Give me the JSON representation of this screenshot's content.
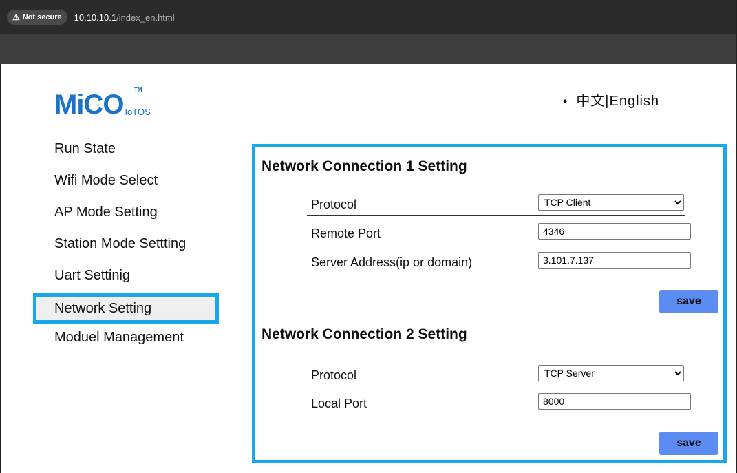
{
  "browser": {
    "security_label": "Not secure",
    "url_host": "10.10.10.1",
    "url_path": "/index_en.html"
  },
  "logo": {
    "text": "MiCO",
    "sub": "IoTOS",
    "tm": "TM"
  },
  "language": {
    "text": "中文|English"
  },
  "sidebar": {
    "items": [
      {
        "label": "Run State"
      },
      {
        "label": "Wifi Mode Select"
      },
      {
        "label": "AP Mode Setting"
      },
      {
        "label": "Station Mode Settting"
      },
      {
        "label": "Uart Settinig"
      },
      {
        "label": "Network Setting"
      },
      {
        "label": "Moduel Management"
      }
    ]
  },
  "conn1": {
    "title": "Network Connection 1 Setting",
    "protocol_label": "Protocol",
    "protocol_value": "TCP Client",
    "remote_port_label": "Remote Port",
    "remote_port_value": "4346",
    "server_label": "Server Address(ip or domain)",
    "server_value": "3.101.7.137",
    "save_label": "save"
  },
  "conn2": {
    "title": "Network Connection 2 Setting",
    "protocol_label": "Protocol",
    "protocol_value": "TCP Server",
    "local_port_label": "Local Port",
    "local_port_value": "8000",
    "save_label": "save"
  },
  "colors": {
    "accent": "#18a7e8",
    "button": "#5b8cf2",
    "logo": "#1a73c8"
  }
}
